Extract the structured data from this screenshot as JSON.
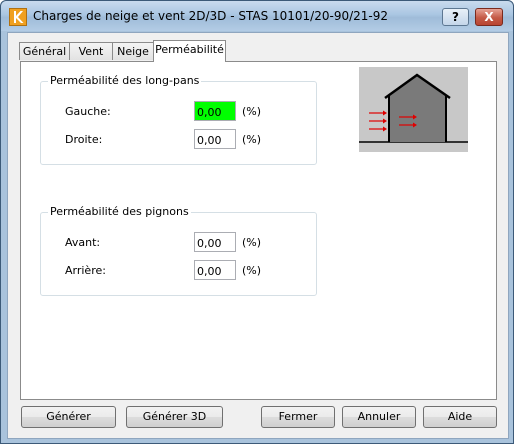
{
  "window": {
    "title": "Charges de neige et vent 2D/3D - STAS 10101/20-90/21-92",
    "help_label": "?",
    "close_label": "X",
    "app_icon": "k-logo-icon"
  },
  "tabs": [
    {
      "label": "Général",
      "active": false
    },
    {
      "label": "Vent",
      "active": false
    },
    {
      "label": "Neige",
      "active": false
    },
    {
      "label": "Perméabilité",
      "active": true
    }
  ],
  "long_pans": {
    "title": "Perméabilité des long-pans",
    "left": {
      "label": "Gauche:",
      "value": "0,00",
      "unit": "(%)"
    },
    "right": {
      "label": "Droite:",
      "value": "0,00",
      "unit": "(%)"
    }
  },
  "pignons": {
    "title": "Perméabilité des pignons",
    "front": {
      "label": "Avant:",
      "value": "0,00",
      "unit": "(%)"
    },
    "back": {
      "label": "Arrière:",
      "value": "0,00",
      "unit": "(%)"
    }
  },
  "buttons": {
    "generate": "Générer",
    "generate_3d": "Générer 3D",
    "close": "Fermer",
    "cancel": "Annuler",
    "help": "Aide"
  },
  "colors": {
    "focused_field": "#00ff00",
    "wind_arrows": "#e00000",
    "building_fill": "#7a7a7a"
  }
}
